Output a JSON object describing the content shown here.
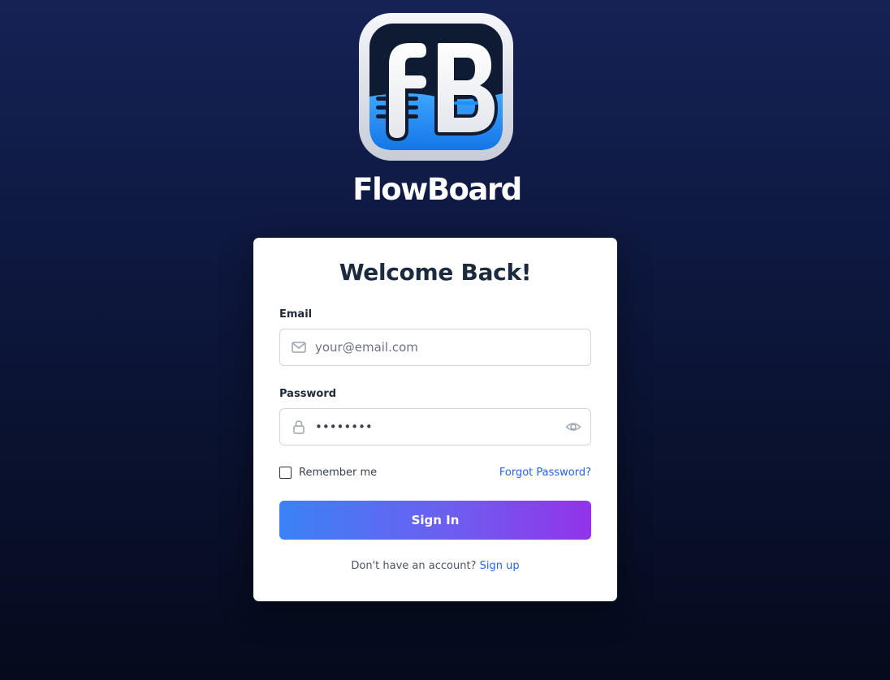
{
  "brand": {
    "logo_letters": "fB",
    "name": "FlowBoard"
  },
  "login": {
    "title": "Welcome Back!",
    "email": {
      "label": "Email",
      "placeholder": "your@email.com",
      "value": "",
      "icon": "mail-icon"
    },
    "password": {
      "label": "Password",
      "value": "••••••••",
      "icon": "lock-icon",
      "toggle_icon": "eye-icon"
    },
    "remember_label": "Remember me",
    "remember_checked": false,
    "forgot_label": "Forgot Password?",
    "submit_label": "Sign In",
    "signup_prompt": "Don't have an account?",
    "signup_link": "Sign up"
  },
  "colors": {
    "accent_blue": "#2563eb",
    "gradient_start": "#3b82f6",
    "gradient_end": "#9333ea",
    "background_top": "#152254",
    "background_bottom": "#050a1c"
  }
}
